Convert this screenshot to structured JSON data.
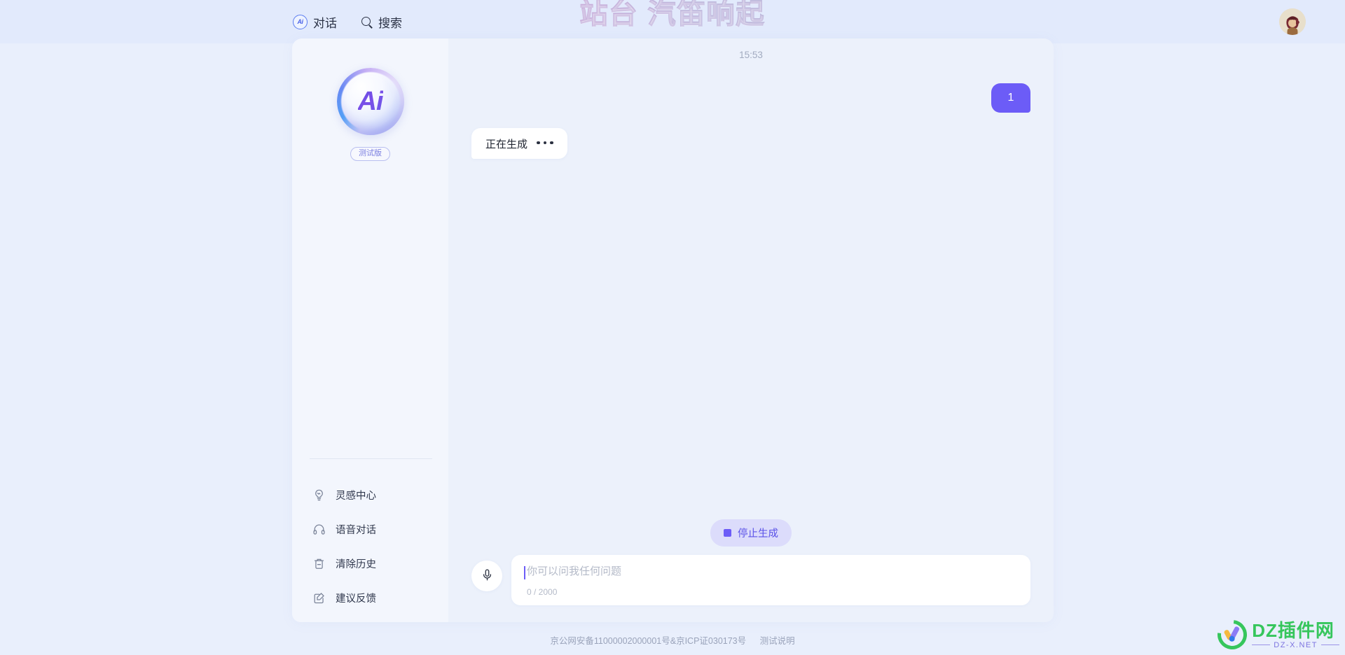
{
  "topnav": {
    "items": [
      {
        "label": "对话",
        "icon": "ai-badge-icon"
      },
      {
        "label": "搜索",
        "icon": "search-icon"
      }
    ]
  },
  "header": {
    "title": "站台 汽笛响起",
    "avatar_alt": "用户头像"
  },
  "sidebar": {
    "logo_text": "Ai",
    "badge": "测试版",
    "items": [
      {
        "label": "灵感中心",
        "icon": "lightbulb-icon"
      },
      {
        "label": "语音对话",
        "icon": "headphones-icon"
      },
      {
        "label": "清除历史",
        "icon": "trash-icon"
      },
      {
        "label": "建议反馈",
        "icon": "feedback-edit-icon"
      }
    ]
  },
  "chat": {
    "time": "15:53",
    "user_message": "1",
    "bot_message": "正在生成",
    "stop_label": "停止生成"
  },
  "composer": {
    "mic_icon": "microphone-icon",
    "placeholder": "你可以问我任何问题",
    "value": "",
    "counter": "0 / 2000"
  },
  "footer": {
    "icp": "京公网安备11000002000001号&京ICP证030173号",
    "link": "测试说明"
  },
  "watermark": {
    "title": "DZ插件网",
    "subtitle": "DZ-X.NET"
  },
  "colors": {
    "accent": "#6c5cf7",
    "accent_soft": "#dcdcfb",
    "page_bg": "#e9effc",
    "topbar_bg": "#e2eafc",
    "sidebar_bg": "#f3f6fd",
    "chat_bg": "#ecf1fb",
    "watermark_green": "#36c65c"
  }
}
